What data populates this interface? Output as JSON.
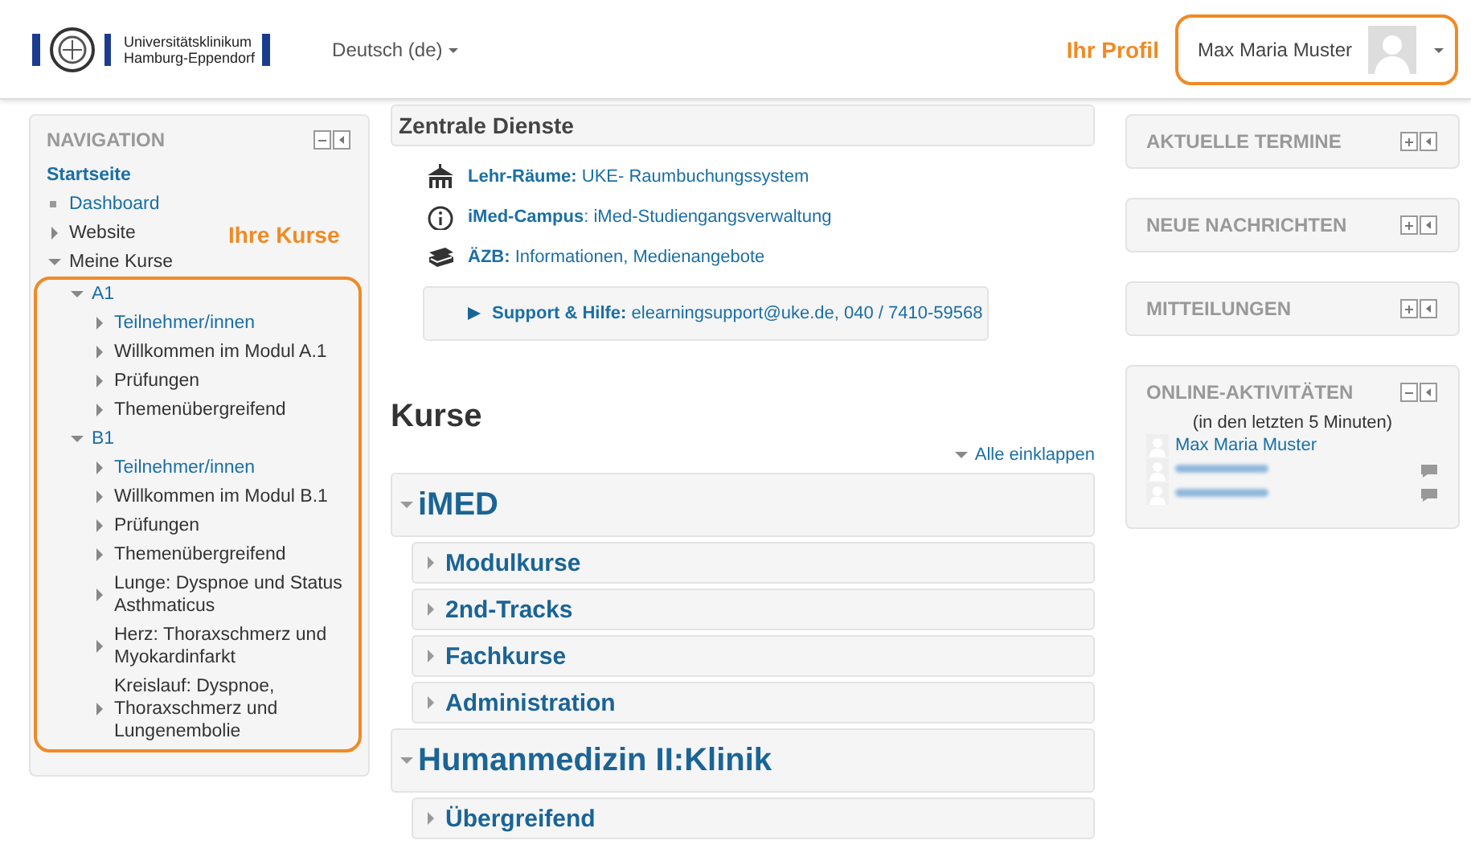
{
  "header": {
    "logo_text": [
      "Universitätsklinikum",
      "Hamburg-Eppendorf"
    ],
    "language": "Deutsch (de)",
    "profile_annotation": "Ihr Profil",
    "user_name": "Max Maria Muster"
  },
  "navigation": {
    "title": "NAVIGATION",
    "courses_annotation": "Ihre Kurse",
    "items": [
      {
        "label": "Startseite",
        "kind": "home"
      },
      {
        "label": "Dashboard",
        "kind": "leaf"
      },
      {
        "label": "Website",
        "kind": "branch",
        "expanded": false
      },
      {
        "label": "Meine Kurse",
        "kind": "branch",
        "expanded": true,
        "children": [
          {
            "label": "A1",
            "kind": "branch",
            "expanded": true,
            "link": true,
            "children": [
              {
                "label": "Teilnehmer/innen",
                "kind": "branch",
                "expanded": false,
                "link": true
              },
              {
                "label": "Willkommen im Modul A.1",
                "kind": "branch",
                "expanded": false
              },
              {
                "label": "Prüfungen",
                "kind": "branch",
                "expanded": false
              },
              {
                "label": "Themenübergreifend",
                "kind": "branch",
                "expanded": false
              }
            ]
          },
          {
            "label": "B1",
            "kind": "branch",
            "expanded": true,
            "link": true,
            "children": [
              {
                "label": "Teilnehmer/innen",
                "kind": "branch",
                "expanded": false,
                "link": true
              },
              {
                "label": "Willkommen im Modul B.1",
                "kind": "branch",
                "expanded": false
              },
              {
                "label": "Prüfungen",
                "kind": "branch",
                "expanded": false
              },
              {
                "label": "Themenübergreifend",
                "kind": "branch",
                "expanded": false
              },
              {
                "label": "Lunge: Dyspnoe und Status Asthmaticus",
                "kind": "branch",
                "expanded": false
              },
              {
                "label": "Herz: Thoraxschmerz und Myokardinfarkt",
                "kind": "branch",
                "expanded": false
              },
              {
                "label": "Kreislauf: Dyspnoe, Thoraxschmerz und Lungenembolie",
                "kind": "branch",
                "expanded": false
              }
            ]
          }
        ]
      }
    ]
  },
  "services": {
    "title": "Zentrale Dienste",
    "items": [
      {
        "kind": "building",
        "text": "**Lehr-Räume:** UKE- Raumbuchungssystem"
      },
      {
        "kind": "info",
        "text": "**iMed-Campus**: iMed-Studiengangsverwaltung"
      },
      {
        "kind": "books",
        "text": "**ÄZB:** Informationen, Medienangebote"
      }
    ],
    "support": "**Support & Hilfe:** elearningsupport@uke.de, 040 / 7410-59568"
  },
  "courses": {
    "title": "Kurse",
    "collapse_all": "Alle einklappen",
    "categories": [
      {
        "name": "iMED",
        "expanded": true,
        "children": [
          {
            "name": "Modulkurse",
            "expanded": false
          },
          {
            "name": "2nd-Tracks",
            "expanded": false
          },
          {
            "name": "Fachkurse",
            "expanded": false
          },
          {
            "name": "Administration",
            "expanded": false
          }
        ]
      },
      {
        "name": "Humanmedizin II:Klinik",
        "expanded": true,
        "children": [
          {
            "name": "Übergreifend",
            "expanded": false
          }
        ]
      }
    ]
  },
  "blocks": [
    {
      "title": "AKTUELLE TERMINE",
      "expanded": false
    },
    {
      "title": "NEUE NACHRICHTEN",
      "expanded": false
    },
    {
      "title": "MITTEILUNGEN",
      "expanded": false
    },
    {
      "title": "ONLINE-AKTIVITÄTEN",
      "expanded": true,
      "subtitle": "(in den letzten 5 Minuten)",
      "users": [
        {
          "name": "Max Maria Muster",
          "message_icon": false
        },
        {
          "name_hidden": true,
          "message_icon": true
        },
        {
          "name_hidden": true,
          "message_icon": true
        }
      ]
    }
  ]
}
